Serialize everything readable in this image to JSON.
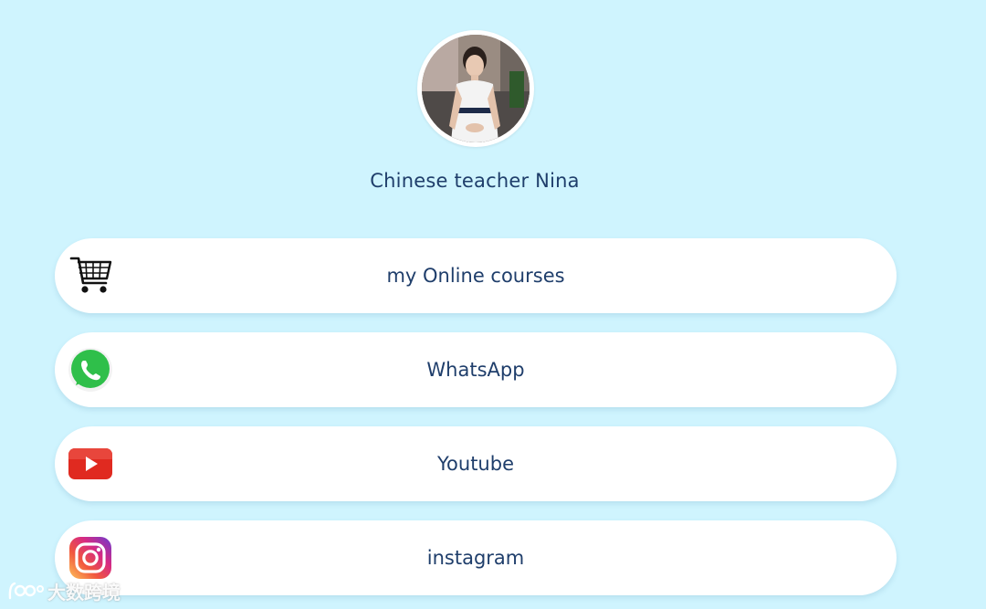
{
  "profile": {
    "name": "Chinese teacher Nina",
    "avatar_icon": "profile-photo"
  },
  "links": [
    {
      "label": "my Online courses",
      "icon": "shopping-cart-icon"
    },
    {
      "label": "WhatsApp",
      "icon": "whatsapp-icon"
    },
    {
      "label": "Youtube",
      "icon": "youtube-icon"
    },
    {
      "label": "instagram",
      "icon": "instagram-icon"
    }
  ],
  "colors": {
    "background": "#cff4fe",
    "button": "#ffffff",
    "text": "#1f3e6b",
    "whatsapp": "#2fbf4a",
    "youtube": "#e02a20"
  },
  "watermark": {
    "text": "大数跨境"
  }
}
